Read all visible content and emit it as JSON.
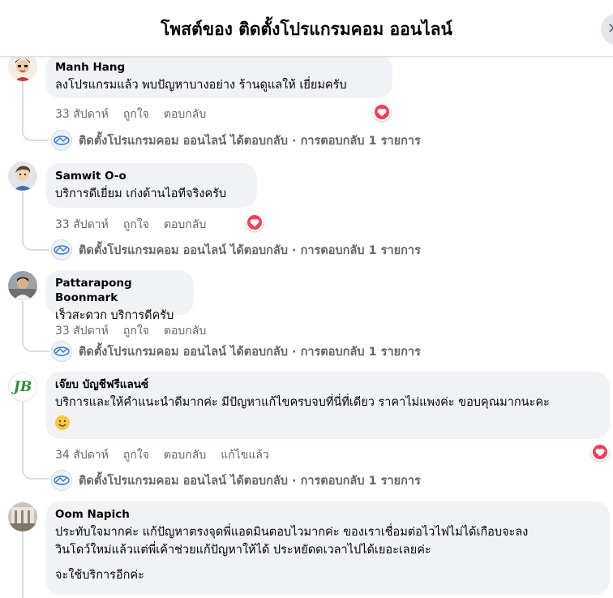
{
  "header": {
    "title": "โพสต์ของ ติดตั้งโปรแกรมคอม ออนไลน์",
    "close_glyph": "✕"
  },
  "comments": [
    {
      "author": "Manh Hang",
      "text": "ลงโปรแกรมแล้ว พบปัญหาบางอย่าง ร้านดูแลให้ เยี่ยมครับ",
      "time": "33 สัปดาห์",
      "like": "ถูกใจ",
      "reply": "ตอบกลับ",
      "reaction": "love",
      "page_reply": "ติดตั้งโปรแกรมคอม ออนไลน์ ได้ตอบกลับ · การตอบกลับ 1 รายการ"
    },
    {
      "author": "Samwit O-o",
      "text": "บริการดีเยี่ยม เก่งด้านไอทีจริงครับ",
      "time": "33 สัปดาห์",
      "like": "ถูกใจ",
      "reply": "ตอบกลับ",
      "reaction": "love",
      "page_reply": "ติดตั้งโปรแกรมคอม ออนไลน์ ได้ตอบกลับ · การตอบกลับ 1 รายการ"
    },
    {
      "author": "Pattarapong Boonmark",
      "text": "เร็วสะดวก บริการดีครับ",
      "time": "33 สัปดาห์",
      "like": "ถูกใจ",
      "reply": "ตอบกลับ",
      "page_reply": "ติดตั้งโปรแกรมคอม ออนไลน์ ได้ตอบกลับ · การตอบกลับ 1 รายการ"
    },
    {
      "author": "เจ๊ยบ บัญชีฟรีแลนซ์",
      "avatar_text": "JB",
      "text": "บริการและให้คำแนะนำดีมากค่ะ มีปัญหาแก้ไขครบจบที่นี่ที่เดียว ราคาไม่แพงค่ะ ขอบคุณมากนะคะ",
      "emoji": "smiley-emoji",
      "time": "34 สัปดาห์",
      "like": "ถูกใจ",
      "reply": "ตอบกลับ",
      "edited": "แก้ไขแล้ว",
      "reaction": "love",
      "page_reply": "ติดตั้งโปรแกรมคอม ออนไลน์ ได้ตอบกลับ · การตอบกลับ 1 รายการ"
    },
    {
      "author": "Oom Napich",
      "text_line1": "ประทับใจมากค่ะ แก้ปัญหาตรงจุดพี่แอดมินตอบไวมากค่ะ ของเราเชื่อมต่อไวไฟไม่ได้เกือบจะลง",
      "text_line2": "วินโดว์ใหม่แล้วแต่พี่เค้าช่วยแก้ปัญหาให้ได้ ประหยัดดเวลาไปได้เยอะเลยค่ะ",
      "text_line3": "จะใช้บริการอีกค่ะ"
    }
  ],
  "colors": {
    "bubble": "#f0f2f5",
    "meta": "#65676b",
    "love": "#f33e58",
    "jb_green": "#2e8b3a"
  }
}
